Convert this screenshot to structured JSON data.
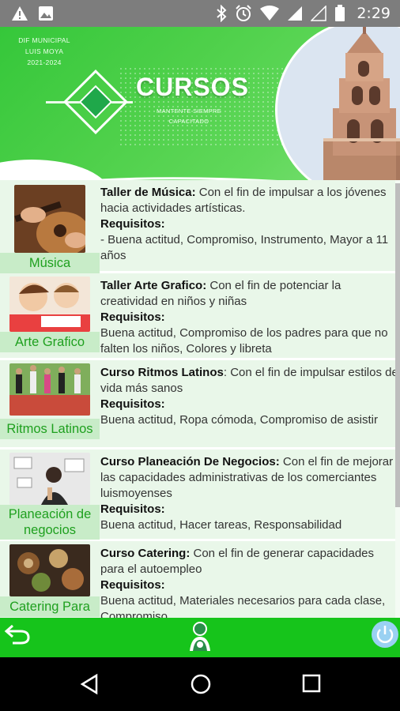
{
  "status_bar": {
    "time": "2:29",
    "left_icons": [
      "warning-icon",
      "image-icon"
    ],
    "right_icons": [
      "bluetooth-icon",
      "alarm-icon",
      "wifi-icon",
      "signal-icon",
      "no-signal-icon",
      "battery-icon"
    ]
  },
  "header": {
    "org_line1": "DIF MUNICIPAL",
    "org_line2": "LUIS MOYA",
    "org_line3": "2021-2024",
    "title": "CURSOS",
    "subtitle_line1": "MANTENTE SIEMPRE",
    "subtitle_line2": "CAPACITADO"
  },
  "courses": [
    {
      "caption": "Música",
      "title": "Taller de Música:",
      "description": " Con el fin de impulsar a los jóvenes hacia actividades artísticas.",
      "req_label": "Requisitos:",
      "requirements": "- Buena actitud, Compromiso, Instrumento, Mayor a 11 años"
    },
    {
      "caption": "Arte Grafico",
      "title": "Taller Arte Grafico:",
      "description": " Con el fin de potenciar la creatividad en niños y niñas",
      "req_label": "Requisitos:",
      "requirements": "Buena actitud, Compromiso de los padres para que no falten los niños, Colores y libreta"
    },
    {
      "caption": "Ritmos Latinos",
      "title": "Curso Ritmos Latinos",
      "description": ": Con el fin de impulsar estilos de vida más sanos",
      "req_label": "Requisitos:",
      "requirements": "Buena actitud, Ropa cómoda, Compromiso de asistir"
    },
    {
      "caption": "Planeación de negocios",
      "title": "Curso Planeación De Negocios:",
      "description": " Con el fin de mejorar las capacidades administrativas de los comerciantes luismoyenses",
      "req_label": "Requisitos:",
      "requirements": "Buena actitud, Hacer tareas, Responsabilidad"
    },
    {
      "caption": "Catering Para",
      "title": "Curso Catering:",
      "description": " Con el fin de generar capacidades para el autoempleo",
      "req_label": "Requisitos:",
      "requirements": "Buena actitud, Materiales necesarios para cada clase, Compromiso"
    }
  ],
  "bottom_bar": {
    "icons": [
      "back-arrow-icon",
      "dif-logo-icon",
      "power-icon"
    ]
  },
  "colors": {
    "accent_green": "#16c41b",
    "caption_green": "#1fa01f",
    "row_bg": "#e9f7e9"
  }
}
